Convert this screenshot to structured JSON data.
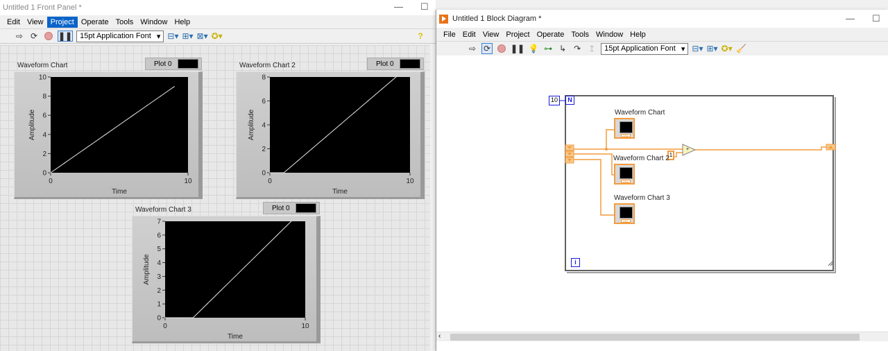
{
  "front_panel": {
    "title": "Untitled 1 Front Panel *",
    "menu": [
      "Edit",
      "View",
      "Project",
      "Operate",
      "Tools",
      "Window",
      "Help"
    ],
    "active_menu": "Project",
    "toolbar": {
      "run_icon": "run-arrow-icon",
      "run_continuous_icon": "run-continuously-icon",
      "abort_icon": "abort-icon",
      "pause_icon": "pause-icon",
      "font": "15pt Application Font",
      "align_icon": "align-objects-icon",
      "distribute_icon": "distribute-objects-icon",
      "resize_icon": "resize-objects-icon",
      "reorder_icon": "reorder-icon",
      "help_icon": "context-help-icon"
    },
    "window_controls": {
      "minimize": "—",
      "maximize": "☐",
      "close": "✕"
    }
  },
  "block_diagram": {
    "title": "Untitled 1 Block Diagram *",
    "menu": [
      "File",
      "Edit",
      "View",
      "Project",
      "Operate",
      "Tools",
      "Window",
      "Help"
    ],
    "toolbar": {
      "font": "15pt Application Font"
    },
    "window_controls": {
      "minimize": "—",
      "maximize": "☐"
    },
    "for_loop": {
      "count_constant": "10",
      "count_terminal": "N",
      "iteration_terminal": "i"
    },
    "nodes": [
      {
        "label": "Waveform Chart"
      },
      {
        "label": "Waveform Chart 2"
      },
      {
        "label": "Waveform Chart 3"
      }
    ],
    "constant": "1",
    "add_function": "+",
    "wire_color": "#f39c3f",
    "loop_border_color": "#606060",
    "terminal_color": "#1a1adc"
  },
  "chart_data": [
    {
      "type": "line",
      "title": "Waveform Chart",
      "legend": "Plot 0",
      "xlabel": "Time",
      "ylabel": "Amplitude",
      "xlim": [
        0,
        10
      ],
      "ylim": [
        0,
        10
      ],
      "xticks": [
        "0",
        "10"
      ],
      "yticks": [
        "0",
        "2",
        "4",
        "6",
        "8",
        "10"
      ],
      "x": [
        0,
        1,
        2,
        3,
        4,
        5,
        6,
        7,
        8,
        9
      ],
      "y": [
        0,
        1,
        2,
        3,
        4,
        5,
        6,
        7,
        8,
        9
      ]
    },
    {
      "type": "line",
      "title": "Waveform Chart 2",
      "legend": "Plot 0",
      "xlabel": "Time",
      "ylabel": "Amplitude",
      "xlim": [
        0,
        10
      ],
      "ylim": [
        0,
        8
      ],
      "xticks": [
        "0",
        "10"
      ],
      "yticks": [
        "0",
        "2",
        "4",
        "6",
        "8"
      ],
      "x": [
        0,
        1,
        2,
        3,
        4,
        5,
        6,
        7,
        8,
        9
      ],
      "y": [
        0,
        0,
        1,
        2,
        3,
        4,
        5,
        6,
        7,
        8
      ]
    },
    {
      "type": "line",
      "title": "Waveform Chart 3",
      "legend": "Plot 0",
      "xlabel": "Time",
      "ylabel": "Amplitude",
      "xlim": [
        0,
        10
      ],
      "ylim": [
        0,
        7
      ],
      "xticks": [
        "0",
        "10"
      ],
      "yticks": [
        "0",
        "1",
        "2",
        "3",
        "4",
        "5",
        "6",
        "7"
      ],
      "x": [
        0,
        1,
        2,
        3,
        4,
        5,
        6,
        7,
        8,
        9
      ],
      "y": [
        0,
        0,
        0,
        1,
        2,
        3,
        4,
        5,
        6,
        7
      ]
    }
  ]
}
